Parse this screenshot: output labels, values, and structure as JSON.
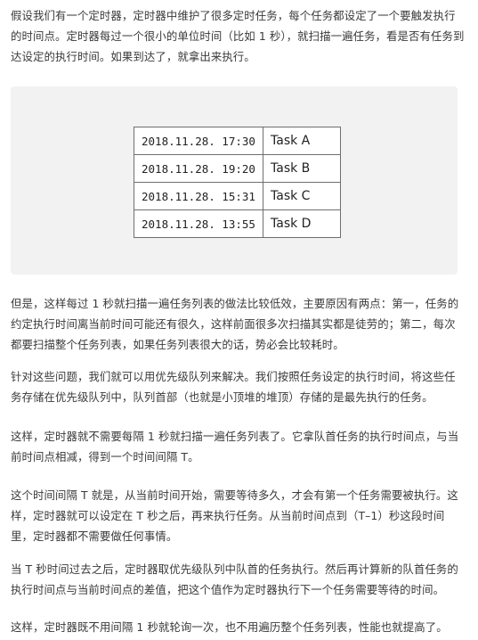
{
  "paragraphs": [
    "假设我们有一个定时器，定时器中维护了很多定时任务，每个任务都设定了一个要触发执行的时间点。定时器每过一个很小的单位时间（比如 1 秒），就扫描一遍任务，看是否有任务到达设定的执行时间。如果到达了，就拿出来执行。",
    "但是，这样每过 1 秒就扫描一遍任务列表的做法比较低效，主要原因有两点：第一，任务的约定执行时间离当前时间可能还有很久，这样前面很多次扫描其实都是徒劳的；第二，每次都要扫描整个任务列表，如果任务列表很大的话，势必会比较耗时。",
    "针对这些问题，我们就可以用优先级队列来解决。我们按照任务设定的执行时间，将这些任务存储在优先级队列中，队列首部（也就是小顶堆的堆顶）存储的是最先执行的任务。",
    "这样，定时器就不需要每隔 1 秒就扫描一遍任务列表了。它拿队首任务的执行时间点，与当前时间点相减，得到一个时间间隔 T。",
    "这个时间间隔 T 就是，从当前时间开始，需要等待多久，才会有第一个任务需要被执行。这样，定时器就可以设定在 T 秒之后，再来执行任务。从当前时间点到（T–1）秒这段时间里，定时器都不需要做任何事情。",
    "当 T 秒时间过去之后，定时器取优先级队列中队首的任务执行。然后再计算新的队首任务的执行时间点与当前时间点的差值，把这个值作为定时器执行下一个任务需要等待的时间。",
    "这样，定时器既不用间隔 1 秒就轮询一次，也不用遍历整个任务列表，性能也就提高了。"
  ],
  "task_table": {
    "rows": [
      {
        "time": "2018.11.28. 17:30",
        "task": "Task A"
      },
      {
        "time": "2018.11.28. 19:20",
        "task": "Task B"
      },
      {
        "time": "2018.11.28. 15:31",
        "task": "Task C"
      },
      {
        "time": "2018.11.28. 13:55",
        "task": "Task D"
      }
    ]
  }
}
